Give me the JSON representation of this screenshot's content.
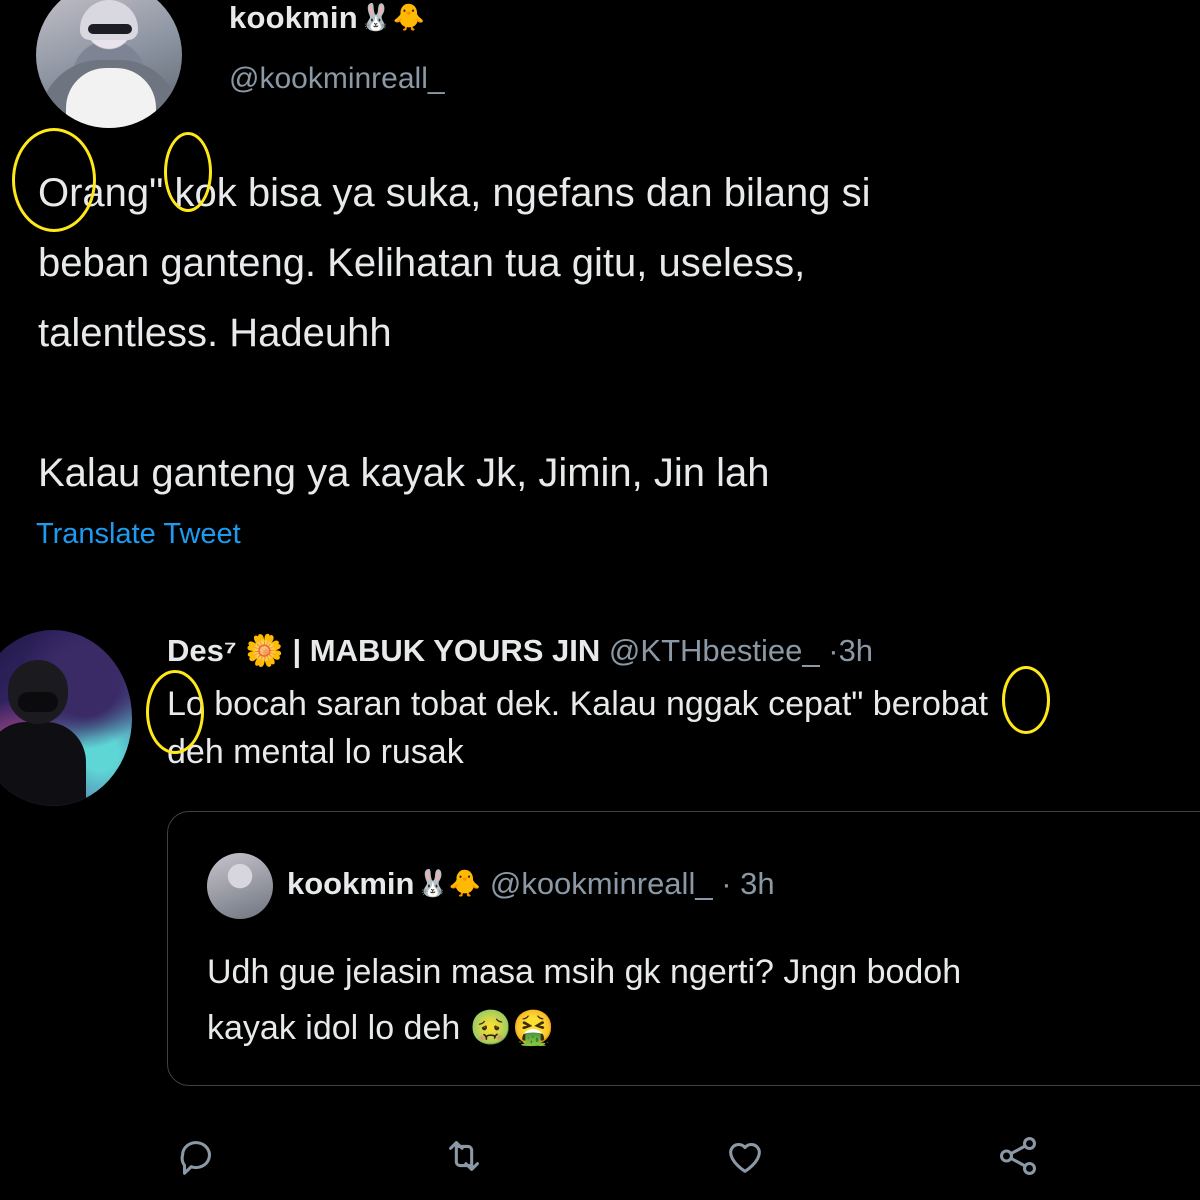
{
  "tweet": {
    "author_name": "kookmin",
    "author_emoji": "🐰🐥",
    "author_handle": "@kookminreall_",
    "text": "Orang\" kok bisa ya suka, ngefans dan bilang si\nbeban ganteng. Kelihatan tua gitu, useless,\ntalentless. Hadeuhh\n\nKalau ganteng ya kayak Jk, Jimin, Jin lah",
    "translate_label": "Translate Tweet"
  },
  "reply": {
    "author_name": "Des⁷ 🌼 | MABUK YOURS JIN",
    "author_handle": "@KTHbestiee_",
    "separator": "·",
    "time": "3h",
    "text": "Lo bocah saran tobat dek. Kalau nggak cepat\" berobat\ndeh mental lo rusak"
  },
  "quoted_tweet": {
    "author_name": "kookmin",
    "author_emoji": "🐰🐥",
    "author_handle": "@kookminreall_",
    "separator": "·",
    "time": "3h",
    "text": "Udh gue jelasin masa msih gk ngerti? Jngn bodoh\nkayak idol lo deh 🤢🤮"
  },
  "actions": {
    "reply_icon": "reply-icon",
    "retweet_icon": "retweet-icon",
    "like_icon": "heart-icon",
    "share_icon": "share-icon"
  },
  "colors": {
    "background": "#000000",
    "text": "#e7e9ea",
    "secondary": "#8b98a5",
    "link": "#1d9bf0",
    "annotation": "#ffe81a"
  }
}
